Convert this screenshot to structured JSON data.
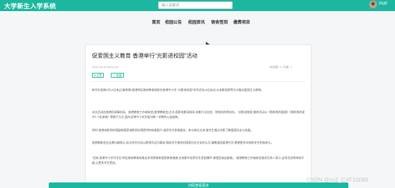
{
  "header": {
    "app_title": "大学新生入学系统",
    "search_placeholder": "输入关键词",
    "user_name": "PMF"
  },
  "nav": {
    "items": [
      {
        "label": "首页"
      },
      {
        "label": "校园公告"
      },
      {
        "label": "校园资讯"
      },
      {
        "label": "宿舍签到"
      },
      {
        "label": "缴费项目"
      }
    ]
  },
  "article": {
    "title": "促爱国主义教育 香港举行“光影进校园”活动",
    "date": "2022-03-15 09:42:29",
    "views": "浏览量: 1 | 作者: 1",
    "like_label": "点赞",
    "favorite_label": "收藏",
    "paragraphs": [
      "新华社香港3月15日电(记者陈辉)香港特区政府教育局联合香港中小学,“光影进校园”系列活动15日启动,以电影观赏等方式推动爱国主义教育。",
      "本次活动由香港民政事务局、香港教育工作者联会(香港教联会)主办,国家电影局指导,电影行业协会、院线机构等协办。“光影进校园”放映活动以《我和我的祖国》《我和我的家乡》《长津湖》等影片为主,面向全港中小学开展为期一学期的公益放映。",
      "同时,香港电影资料馆展映国家电影资料馆提供的修复影片,组织学生参观展览、参与映后交流,使学生通过光影了解祖国历史与发展。",
      "香港教联会会长黄均瑜表示,此次系列活动以影视作品为载体,帮助学生增进对国家历史文化的认识,凝聚爱国爱港共识,期望更多学校和学生积极参与。",
      "“目前,香港中小学开学后,特区政府教育局推出多项德育和国民教育措施,在电影中培养学生家国情怀,增强民族自豪感。”香港教育工作者联会相关负责人表示,这项活动将持续开展,让更多学生受益。"
    ]
  },
  "bottom": {
    "label": "扫码查看更多"
  },
  "watermark": "CSDN @vx2_CXF10088",
  "colors": {
    "accent": "#1bb7a0",
    "background": "#f5f6f7"
  }
}
